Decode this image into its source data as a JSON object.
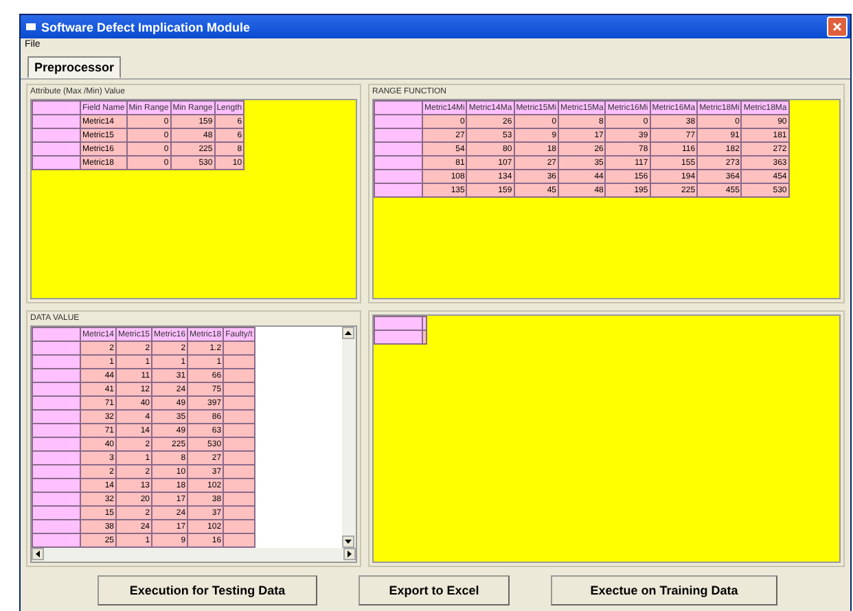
{
  "window": {
    "title": "Software Defect Implication Module"
  },
  "menu": [
    "File"
  ],
  "tabs": [
    {
      "label": "Preprocessor",
      "selected": true
    }
  ],
  "attribute_panel": {
    "title": "Attribute (Max /Min) Value",
    "columns": [
      "Field Name",
      "Min Range",
      "Min Range",
      "Length"
    ],
    "rows": [
      [
        "Metric14",
        "0",
        "159",
        "6"
      ],
      [
        "Metric15",
        "0",
        "48",
        "6"
      ],
      [
        "Metric16",
        "0",
        "225",
        "8"
      ],
      [
        "Metric18",
        "0",
        "530",
        "10"
      ]
    ]
  },
  "range_panel": {
    "title": "RANGE FUNCTION",
    "columns": [
      "Metric14Mi",
      "Metric14Ma",
      "Metric15Mi",
      "Metric15Ma",
      "Metric16Mi",
      "Metric16Ma",
      "Metric18Mi",
      "Metric18Ma"
    ],
    "rows": [
      [
        "0",
        "26",
        "0",
        "8",
        "0",
        "38",
        "0",
        "90"
      ],
      [
        "27",
        "53",
        "9",
        "17",
        "39",
        "77",
        "91",
        "181"
      ],
      [
        "54",
        "80",
        "18",
        "26",
        "78",
        "116",
        "182",
        "272"
      ],
      [
        "81",
        "107",
        "27",
        "35",
        "117",
        "155",
        "273",
        "363"
      ],
      [
        "108",
        "134",
        "36",
        "44",
        "156",
        "194",
        "364",
        "454"
      ],
      [
        "135",
        "159",
        "45",
        "48",
        "195",
        "225",
        "455",
        "530"
      ]
    ]
  },
  "data_panel": {
    "title": "DATA VALUE",
    "columns": [
      "Metric14",
      "Metric15",
      "Metric16",
      "Metric18",
      "Faulty/t"
    ],
    "rows": [
      [
        "2",
        "2",
        "2",
        "1.2"
      ],
      [
        "1",
        "1",
        "1",
        "1"
      ],
      [
        "44",
        "11",
        "31",
        "66"
      ],
      [
        "41",
        "12",
        "24",
        "75"
      ],
      [
        "71",
        "40",
        "49",
        "397"
      ],
      [
        "32",
        "4",
        "35",
        "86"
      ],
      [
        "71",
        "14",
        "49",
        "63"
      ],
      [
        "40",
        "2",
        "225",
        "530"
      ],
      [
        "3",
        "1",
        "8",
        "27"
      ],
      [
        "2",
        "2",
        "10",
        "37"
      ],
      [
        "14",
        "13",
        "18",
        "102"
      ],
      [
        "32",
        "20",
        "17",
        "38"
      ],
      [
        "15",
        "2",
        "24",
        "37"
      ],
      [
        "38",
        "24",
        "17",
        "102"
      ],
      [
        "25",
        "1",
        "9",
        "16"
      ]
    ]
  },
  "buttons": [
    "Execution for Testing Data",
    "Export to Excel",
    "Exectue on Training Data"
  ]
}
